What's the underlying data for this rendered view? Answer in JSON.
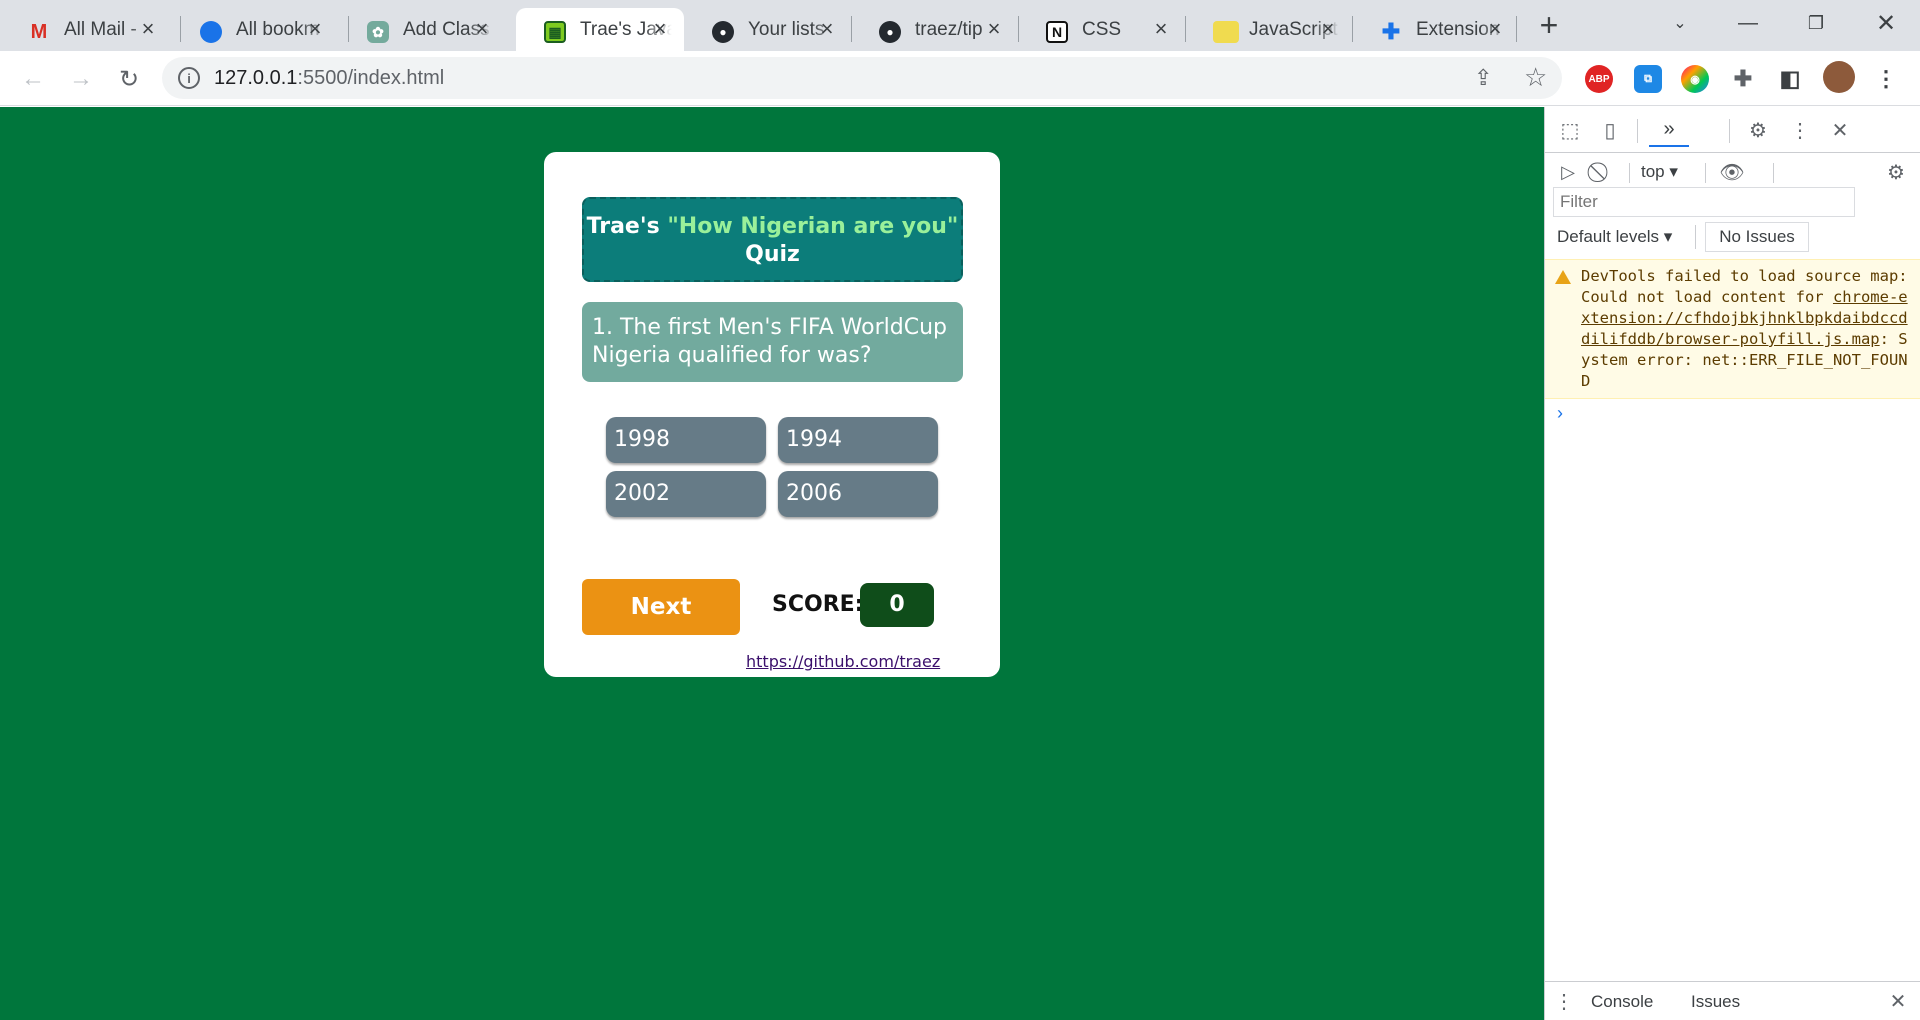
{
  "browser": {
    "tabs": [
      {
        "title": "All Mail - ",
        "icon": "gmail-icon"
      },
      {
        "title": "All bookm",
        "icon": "cloud-icon"
      },
      {
        "title": "Add Class",
        "icon": "chatgpt-icon"
      },
      {
        "title": "Trae's Java",
        "icon": "quiz-app-icon"
      },
      {
        "title": "Your lists",
        "icon": "github-icon"
      },
      {
        "title": "traez/tip",
        "icon": "github-icon"
      },
      {
        "title": "CSS",
        "icon": "notion-icon"
      },
      {
        "title": "JavaScript",
        "icon": "js-icon"
      },
      {
        "title": "Extension",
        "icon": "puzzle-icon"
      }
    ],
    "active_tab_index": 3,
    "url_host": "127.0.0.1",
    "url_rest": ":5500/index.html",
    "extensions": [
      "ABP",
      "chromecast",
      "color-picker",
      "puzzle",
      "sidebar"
    ]
  },
  "quiz": {
    "title_prefix": "Trae's ",
    "title_highlight": "\"How Nigerian are you\"",
    "title_suffix": "Quiz",
    "question": "1. The first Men's FIFA WorldCup Nigeria qualified for was?",
    "answers": [
      "1998",
      "1994",
      "2002",
      "2006"
    ],
    "next_label": "Next",
    "score_label": "SCORE:",
    "score_value": "0",
    "link_text": "https://github.com/traez"
  },
  "devtools": {
    "context": "top",
    "filter_placeholder": "Filter",
    "levels_label": "Default levels",
    "issues_label": "No Issues",
    "warning_text_1": "DevTools failed to load source map: Could not load content for ",
    "warning_link": "chrome-extension://cfhdojbkjhnklbpkdaibdccddilifddb/browser-polyfill.js.map",
    "warning_text_2": ": System error: net::ERR_FILE_NOT_FOUND",
    "drawer_tabs": [
      "Console",
      "Issues"
    ],
    "colors": {
      "warning_bg": "#fffbe6",
      "accent": "#1a73e8"
    }
  },
  "colors": {
    "page_bg": "#00763c",
    "title_bg": "#0c7d7a",
    "question_bg": "#72aa9e",
    "answer_bg": "#667b87",
    "next_bg": "#eb9213",
    "score_bg": "#0f4d1a"
  }
}
